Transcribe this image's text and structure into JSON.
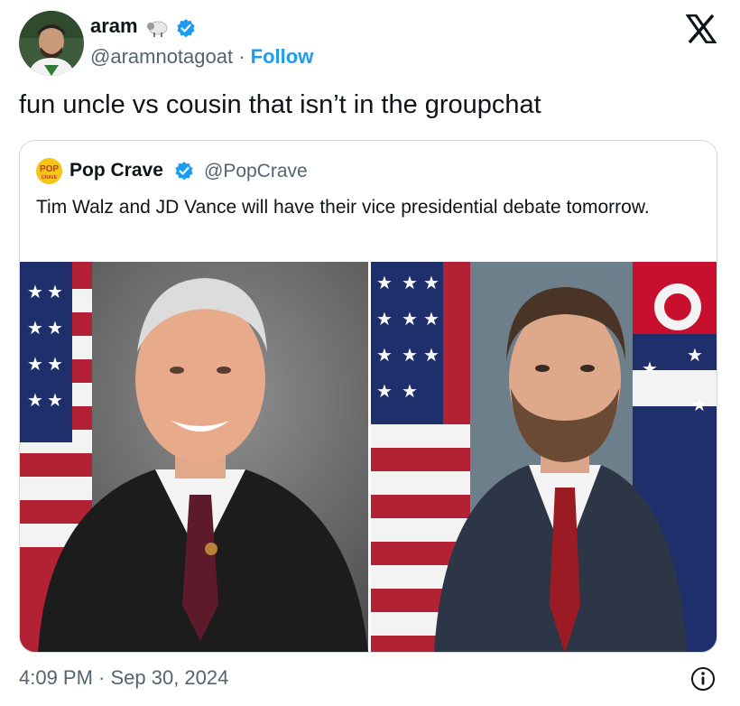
{
  "author": {
    "display_name": "aram",
    "emoji_icon": "sheep-icon",
    "handle": "@aramnotagoat",
    "separator": " · ",
    "follow_label": "Follow"
  },
  "tweet_text": "fun uncle vs cousin that isn’t in the groupchat",
  "quote": {
    "logo_text": "POP",
    "logo_subtext": "CRAVE",
    "display_name": "Pop Crave",
    "handle": "@PopCrave",
    "text": "Tim Walz and JD Vance will have their vice presidential debate tomorrow."
  },
  "timestamp": "4:09 PM · Sep 30, 2024",
  "colors": {
    "accent": "#1d9bf0",
    "text_primary": "#0f1419",
    "text_secondary": "#536471",
    "border": "#cfd9de"
  }
}
